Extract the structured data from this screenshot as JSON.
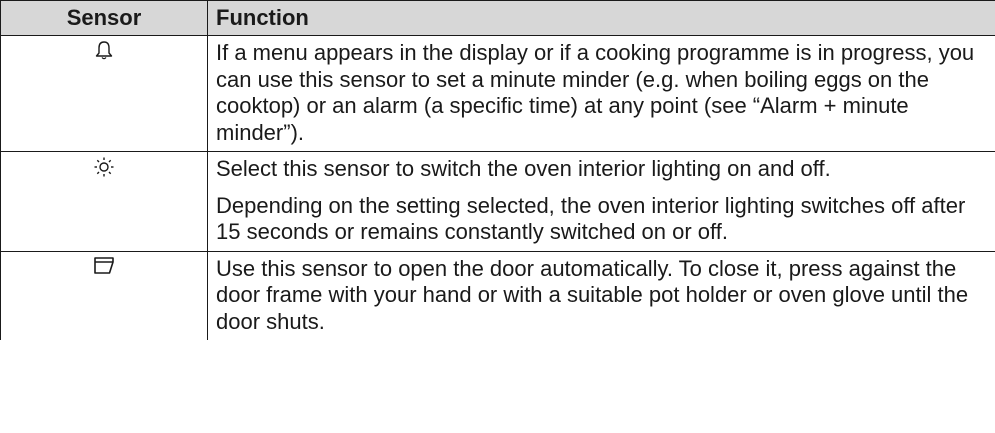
{
  "table": {
    "headers": {
      "sensor": "Sensor",
      "function": "Function"
    },
    "rows": [
      {
        "icon": "bell-icon",
        "paragraphs": [
          "If a menu appears in the display or if a cooking programme is in progress, you can use this sensor to set a minute minder (e.g. when boiling eggs on the cooktop) or an alarm (a specific time) at any point (see “Alarm + minute minder”)."
        ]
      },
      {
        "icon": "light-icon",
        "paragraphs": [
          "Select this sensor to switch the oven interior lighting on and off.",
          "Depending on the setting selected, the oven interior lighting switches off after 15 seconds or remains constantly switched on or off."
        ]
      },
      {
        "icon": "door-open-icon",
        "paragraphs": [
          "Use this sensor to open the door automatically. To close it, press against the door frame with your hand or with a suitable pot holder or oven glove until the door shuts."
        ]
      }
    ]
  }
}
